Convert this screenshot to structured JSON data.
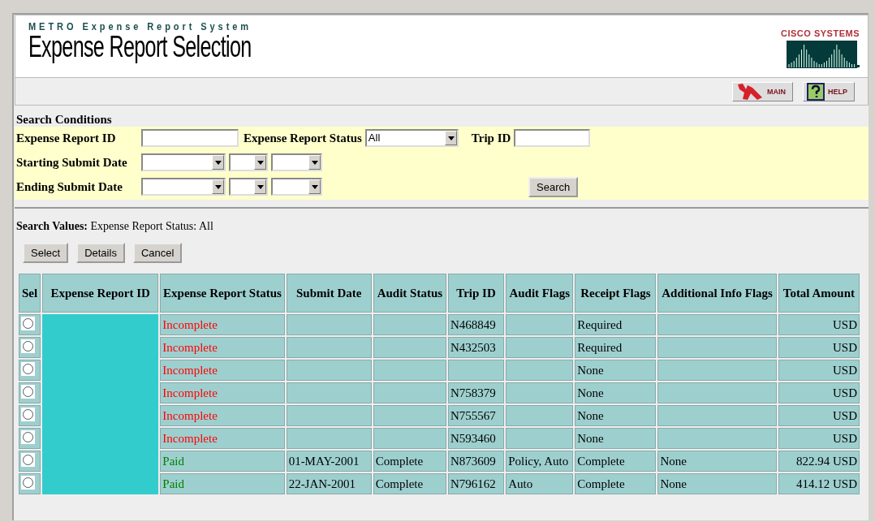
{
  "header": {
    "system": "METRO Expense Report System",
    "title": "Expense Report Selection",
    "logo_text": "CISCO SYSTEMS"
  },
  "toolbar": {
    "buttons": [
      {
        "label": "MAIN",
        "kind": "main"
      },
      {
        "label": "HELP",
        "kind": "help"
      }
    ]
  },
  "search": {
    "title": "Search Conditions",
    "expense_report_id": {
      "label": "Expense Report ID"
    },
    "status": {
      "label": "Expense Report Status",
      "value": "All"
    },
    "trip_id": {
      "label": "Trip ID"
    },
    "date_ranges": [
      {
        "label": "Starting Submit Date"
      },
      {
        "label": "Ending Submit Date"
      }
    ],
    "search_button": "Search"
  },
  "search_values": "**Search Values:** Expense Report Status: All",
  "actions": [
    "Select",
    "Details",
    "Cancel"
  ],
  "table": {
    "columns": [
      "Sel",
      "Expense Report ID",
      "Expense Report Status",
      "Submit Date",
      "Audit Status",
      "Trip ID",
      "Audit Flags",
      "Receipt Flags",
      "Additional Info Flags",
      "Total Amount"
    ],
    "id_column_redacted": true,
    "rows": [
      {
        "selected": false,
        "status": "Incomplete",
        "color": "#ff0000",
        "trip_id": "N468849",
        "receipt_flags": "Required",
        "total_amount": "USD"
      },
      {
        "selected": false,
        "status": "Incomplete",
        "color": "#ff0000",
        "trip_id": "N432503",
        "receipt_flags": "Required",
        "total_amount": "USD"
      },
      {
        "selected": false,
        "status": "Incomplete",
        "color": "#ff0000",
        "receipt_flags": "None",
        "total_amount": "USD"
      },
      {
        "selected": false,
        "status": "Incomplete",
        "color": "#ff0000",
        "trip_id": "N758379",
        "receipt_flags": "None",
        "total_amount": "USD"
      },
      {
        "selected": false,
        "status": "Incomplete",
        "color": "#ff0000",
        "trip_id": "N755567",
        "receipt_flags": "None",
        "total_amount": "USD"
      },
      {
        "selected": false,
        "status": "Incomplete",
        "color": "#ff0000",
        "trip_id": "N593460",
        "receipt_flags": "None",
        "total_amount": "USD"
      },
      {
        "selected": false,
        "status": "Paid",
        "color": "#008000",
        "submit_date": "01-MAY-2001",
        "audit_status": "Complete",
        "trip_id": "N873609",
        "audit_flags": "Policy, Auto",
        "receipt_flags": "Complete",
        "additional_info_flags": "None",
        "total_amount": "822.94 USD"
      },
      {
        "selected": false,
        "status": "Paid",
        "color": "#008000",
        "submit_date": "22-JAN-2001",
        "audit_status": "Complete",
        "trip_id": "N796162",
        "audit_flags": "Auto",
        "receipt_flags": "Complete",
        "additional_info_flags": "None",
        "total_amount": "414.12 USD"
      }
    ]
  }
}
